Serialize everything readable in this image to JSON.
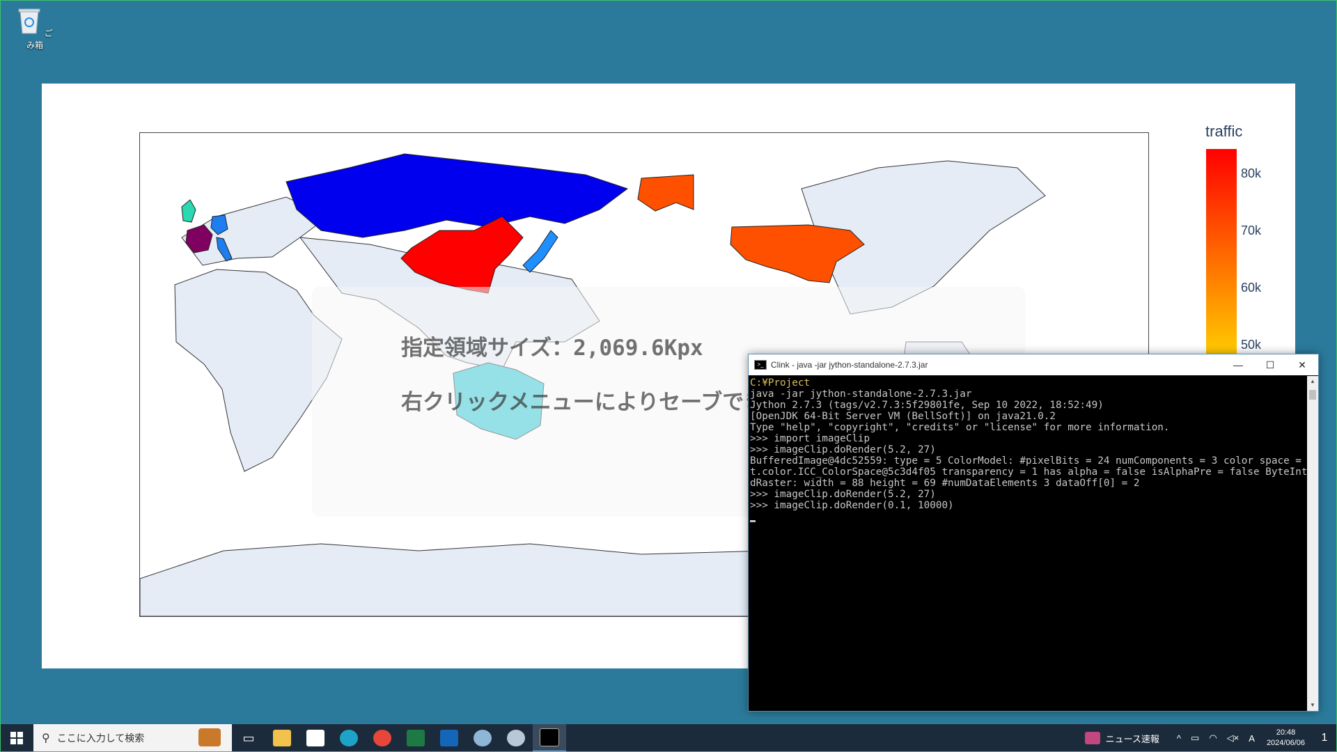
{
  "desktop": {
    "recycle_bin_label": "ごみ箱"
  },
  "chart": {
    "colorbar_title": "traffic",
    "colorbar_ticks": [
      "80k",
      "70k",
      "60k",
      "50k"
    ],
    "overlay_line1": "指定領域サイズ：2,069.6Kpx",
    "overlay_line2": "右クリックメニューによりセーブできます。"
  },
  "chart_data": {
    "type": "choropleth",
    "colorbar_title": "traffic",
    "colorscale": [
      "#55ff00",
      "#ffff00",
      "#ff8800",
      "#ff0000"
    ],
    "tick_values": [
      80000,
      70000,
      60000,
      50000
    ],
    "tick_labels": [
      "80k",
      "70k",
      "60k",
      "50k"
    ],
    "colors": {
      "china": "#ff0000",
      "usa": "#ff5000",
      "russia": "#0000ee",
      "france": "#800060",
      "uk": "#2ad9b0",
      "germany": "#1e7ef0",
      "italy": "#1e7ef0",
      "japan": "#1e8fff",
      "australia": "#22c8d6",
      "other": "#e5ecf6"
    }
  },
  "console": {
    "title": "Clink - java  -jar jython-standalone-2.7.3.jar",
    "minimize": "—",
    "maximize": "☐",
    "close": "✕",
    "lines": [
      "C:¥Project",
      "java -jar jython-standalone-2.7.3.jar",
      "Jython 2.7.3 (tags/v2.7.3:5f29801fe, Sep 10 2022, 18:52:49)",
      "[OpenJDK 64-Bit Server VM (BellSoft)] on java21.0.2",
      "Type \"help\", \"copyright\", \"credits\" or \"license\" for more information.",
      ">>> import imageClip",
      ">>> imageClip.doRender(5.2, 27)",
      "BufferedImage@4dc52559: type = 5 ColorModel: #pixelBits = 24 numComponents = 3 color space = java.aw",
      "t.color.ICC_ColorSpace@5c3d4f05 transparency = 1 has alpha = false isAlphaPre = false ByteInterleave",
      "dRaster: width = 88 height = 69 #numDataElements 3 dataOff[0] = 2",
      ">>> imageClip.doRender(5.2, 27)",
      ">>> imageClip.doRender(0.1, 10000)"
    ]
  },
  "taskbar": {
    "search_placeholder": "ここに入力して検索",
    "news_label": "ニュース速報",
    "time": "20:48",
    "date": "2024/06/06",
    "ime": "A",
    "notification_count": "1"
  }
}
